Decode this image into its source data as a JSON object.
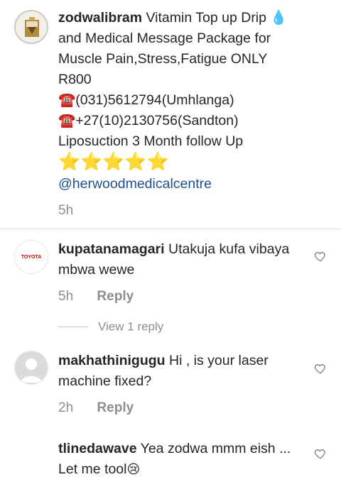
{
  "comments": [
    {
      "username": "zodwalibram",
      "lines": {
        "l1": "Vitamin Top up Drip",
        "drop_icon": "💧",
        "l2": "and Medical Message Package for",
        "l3": "Muscle Pain,Stress,Fatigue ONLY",
        "l4": "R800",
        "phone_icon": "☎️",
        "l5": "(031)5612794(Umhlanga)",
        "l6": "+27(10)2130756(Sandton)",
        "l7": "Liposuction 3 Month follow Up",
        "stars": "⭐⭐⭐⭐⭐",
        "mention": "@herwoodmedicalcentre"
      },
      "time": "5h"
    },
    {
      "username": "kupatanamagari",
      "text_l1": "Utakuja kufa vibaya",
      "text_l2": "mbwa wewe",
      "time": "5h",
      "reply_label": "Reply",
      "avatar_text": "TOYOTA",
      "view_replies": "View 1 reply"
    },
    {
      "username": "makhathinigugu",
      "text_l1": "Hi , is your laser",
      "text_l2": "machine fixed?",
      "time": "2h",
      "reply_label": "Reply"
    },
    {
      "username": "tlinedawave",
      "text_l1": "Yea zodwa mmm eish ...",
      "text_l2": "Let me tool",
      "emoji": "😢"
    }
  ],
  "icons": {
    "heart": "heart-outline-icon",
    "default_avatar": "default-user-avatar"
  },
  "colors": {
    "text": "#262626",
    "secondary": "#8e8e8e",
    "link": "#1f4e8c",
    "divider": "#dbdbdb"
  }
}
